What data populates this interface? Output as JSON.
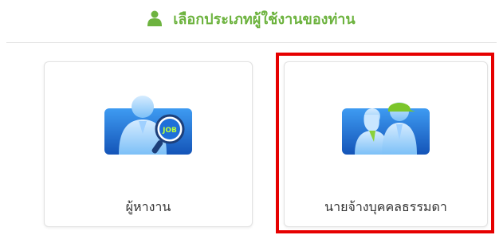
{
  "header": {
    "title": "เลือกประเภทผู้ใช้งานของท่าน",
    "icon": "user-icon",
    "color": "#6db33f"
  },
  "cards": [
    {
      "label": "ผู้หางาน",
      "icon": "job-seeker-icon",
      "badge_text": "JOB",
      "selected": false
    },
    {
      "label": "นายจ้างบุคคลธรรมดา",
      "icon": "employer-icon",
      "selected": true
    }
  ],
  "colors": {
    "highlight": "#e60000",
    "illustration_blue": "#1e6fd9"
  }
}
